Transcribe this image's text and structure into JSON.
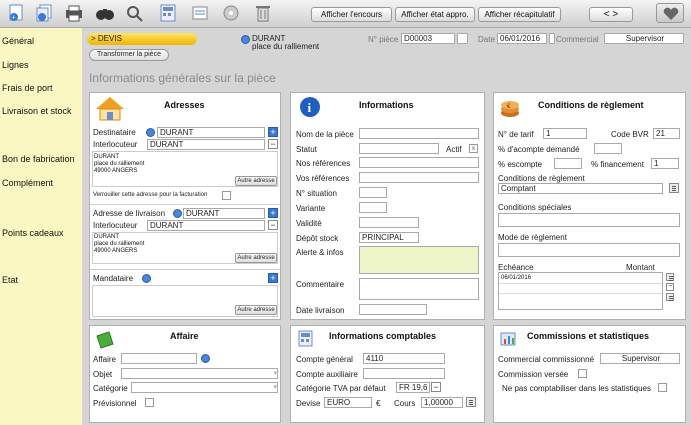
{
  "toolbar": {
    "btn_encours": "Afficher l'encours",
    "btn_etat": "Afficher état appro.",
    "btn_recap": "Afficher récapitulatif",
    "nav": "< >"
  },
  "sidebar": {
    "items": [
      "Général",
      "Lignes",
      "Frais de port",
      "Livraison et stock",
      "Bon de fabrication",
      "Complément",
      "Points cadeaux",
      "Etat"
    ]
  },
  "header": {
    "doc_type": "> DEVIS",
    "transform_label": "Transformer la pièce",
    "client_name": "DURANT",
    "client_address": "place du ralliement",
    "piece_label": "N° pièce",
    "piece_value": "D00003",
    "date_label": "Date",
    "date_value": "06/01/2016",
    "commercial_label": "Commercial",
    "commercial_value": "Supervisor",
    "section_title": "Informations générales sur la pièce"
  },
  "adresses": {
    "title": "Adresses",
    "destinataire_label": "Destinataire",
    "destinataire_value": "DURANT",
    "interlocuteur_label": "Interlocuteur",
    "interlocuteur_value": "DURANT",
    "addr_line1": "DURANT",
    "addr_line2": "place du ralliement",
    "addr_line3": "49000 ANGERS",
    "autre_adresse": "Autre adresse",
    "verrou_label": "Verrouiller cette adresse pour la facturation",
    "livraison_label": "Adresse de livraison",
    "livraison_value": "DURANT",
    "interlocuteur2_value": "DURANT",
    "addr2_line1": "DURANT",
    "addr2_line2": "place du ralliement",
    "addr2_line3": "49000 ANGERS",
    "autre_adresse2": "Autre adresse",
    "mandataire_label": "Mandataire",
    "autre_adresse3": "Autre adresse"
  },
  "informations": {
    "title": "Informations",
    "nom_piece": "Nom de la pièce",
    "statut": "Statut",
    "actif": "Actif",
    "nos_refs": "Nos références",
    "vos_refs": "Vos références",
    "situation": "N° situation",
    "variante": "Variante",
    "validite": "Validité",
    "depot": "Dépôt stock",
    "depot_value": "PRINCIPAL",
    "alerte": "Alerte & infos",
    "commentaire": "Commentaire",
    "date_livraison": "Date livraison"
  },
  "conditions": {
    "title": "Conditions de règlement",
    "tarif_label": "N° de tarif",
    "tarif_value": "1",
    "code_bvr_label": "Code  BVR",
    "code_bvr_value": "21",
    "acompte": "% d'acompte demandé",
    "escompte": "% escompte",
    "financement": "% financement",
    "financement_value": "1",
    "cond_label": "Conditions de règlement",
    "cond_value": "Comptant",
    "cond_spec": "Conditions spéciales",
    "mode": "Mode de règlement",
    "echeance": "Echéance",
    "montant": "Montant",
    "echeance_value": "06/01/2016"
  },
  "affaire": {
    "title": "Affaire",
    "affaire": "Affaire",
    "objet": "Objet",
    "categorie": "Catégorie",
    "previsionnel": "Prévisionnel"
  },
  "comptables": {
    "title": "Informations comptables",
    "general": "Compte général",
    "general_value": "4110",
    "auxiliaire": "Compte auxiliaire",
    "tva": "Catégorie TVA par défaut",
    "tva_value": "FR 19,6",
    "devise": "Devise",
    "devise_value": "EURO",
    "euro_sign": "€",
    "cours": "Cours",
    "cours_value": "1,00000"
  },
  "commissions": {
    "title": "Commissions et statistiques",
    "commercial": "Commercial commissionné",
    "commercial_value": "Supervisor",
    "versee": "Commission versée",
    "pas_compta": "Ne pas comptabiliser dans les statistiques"
  }
}
